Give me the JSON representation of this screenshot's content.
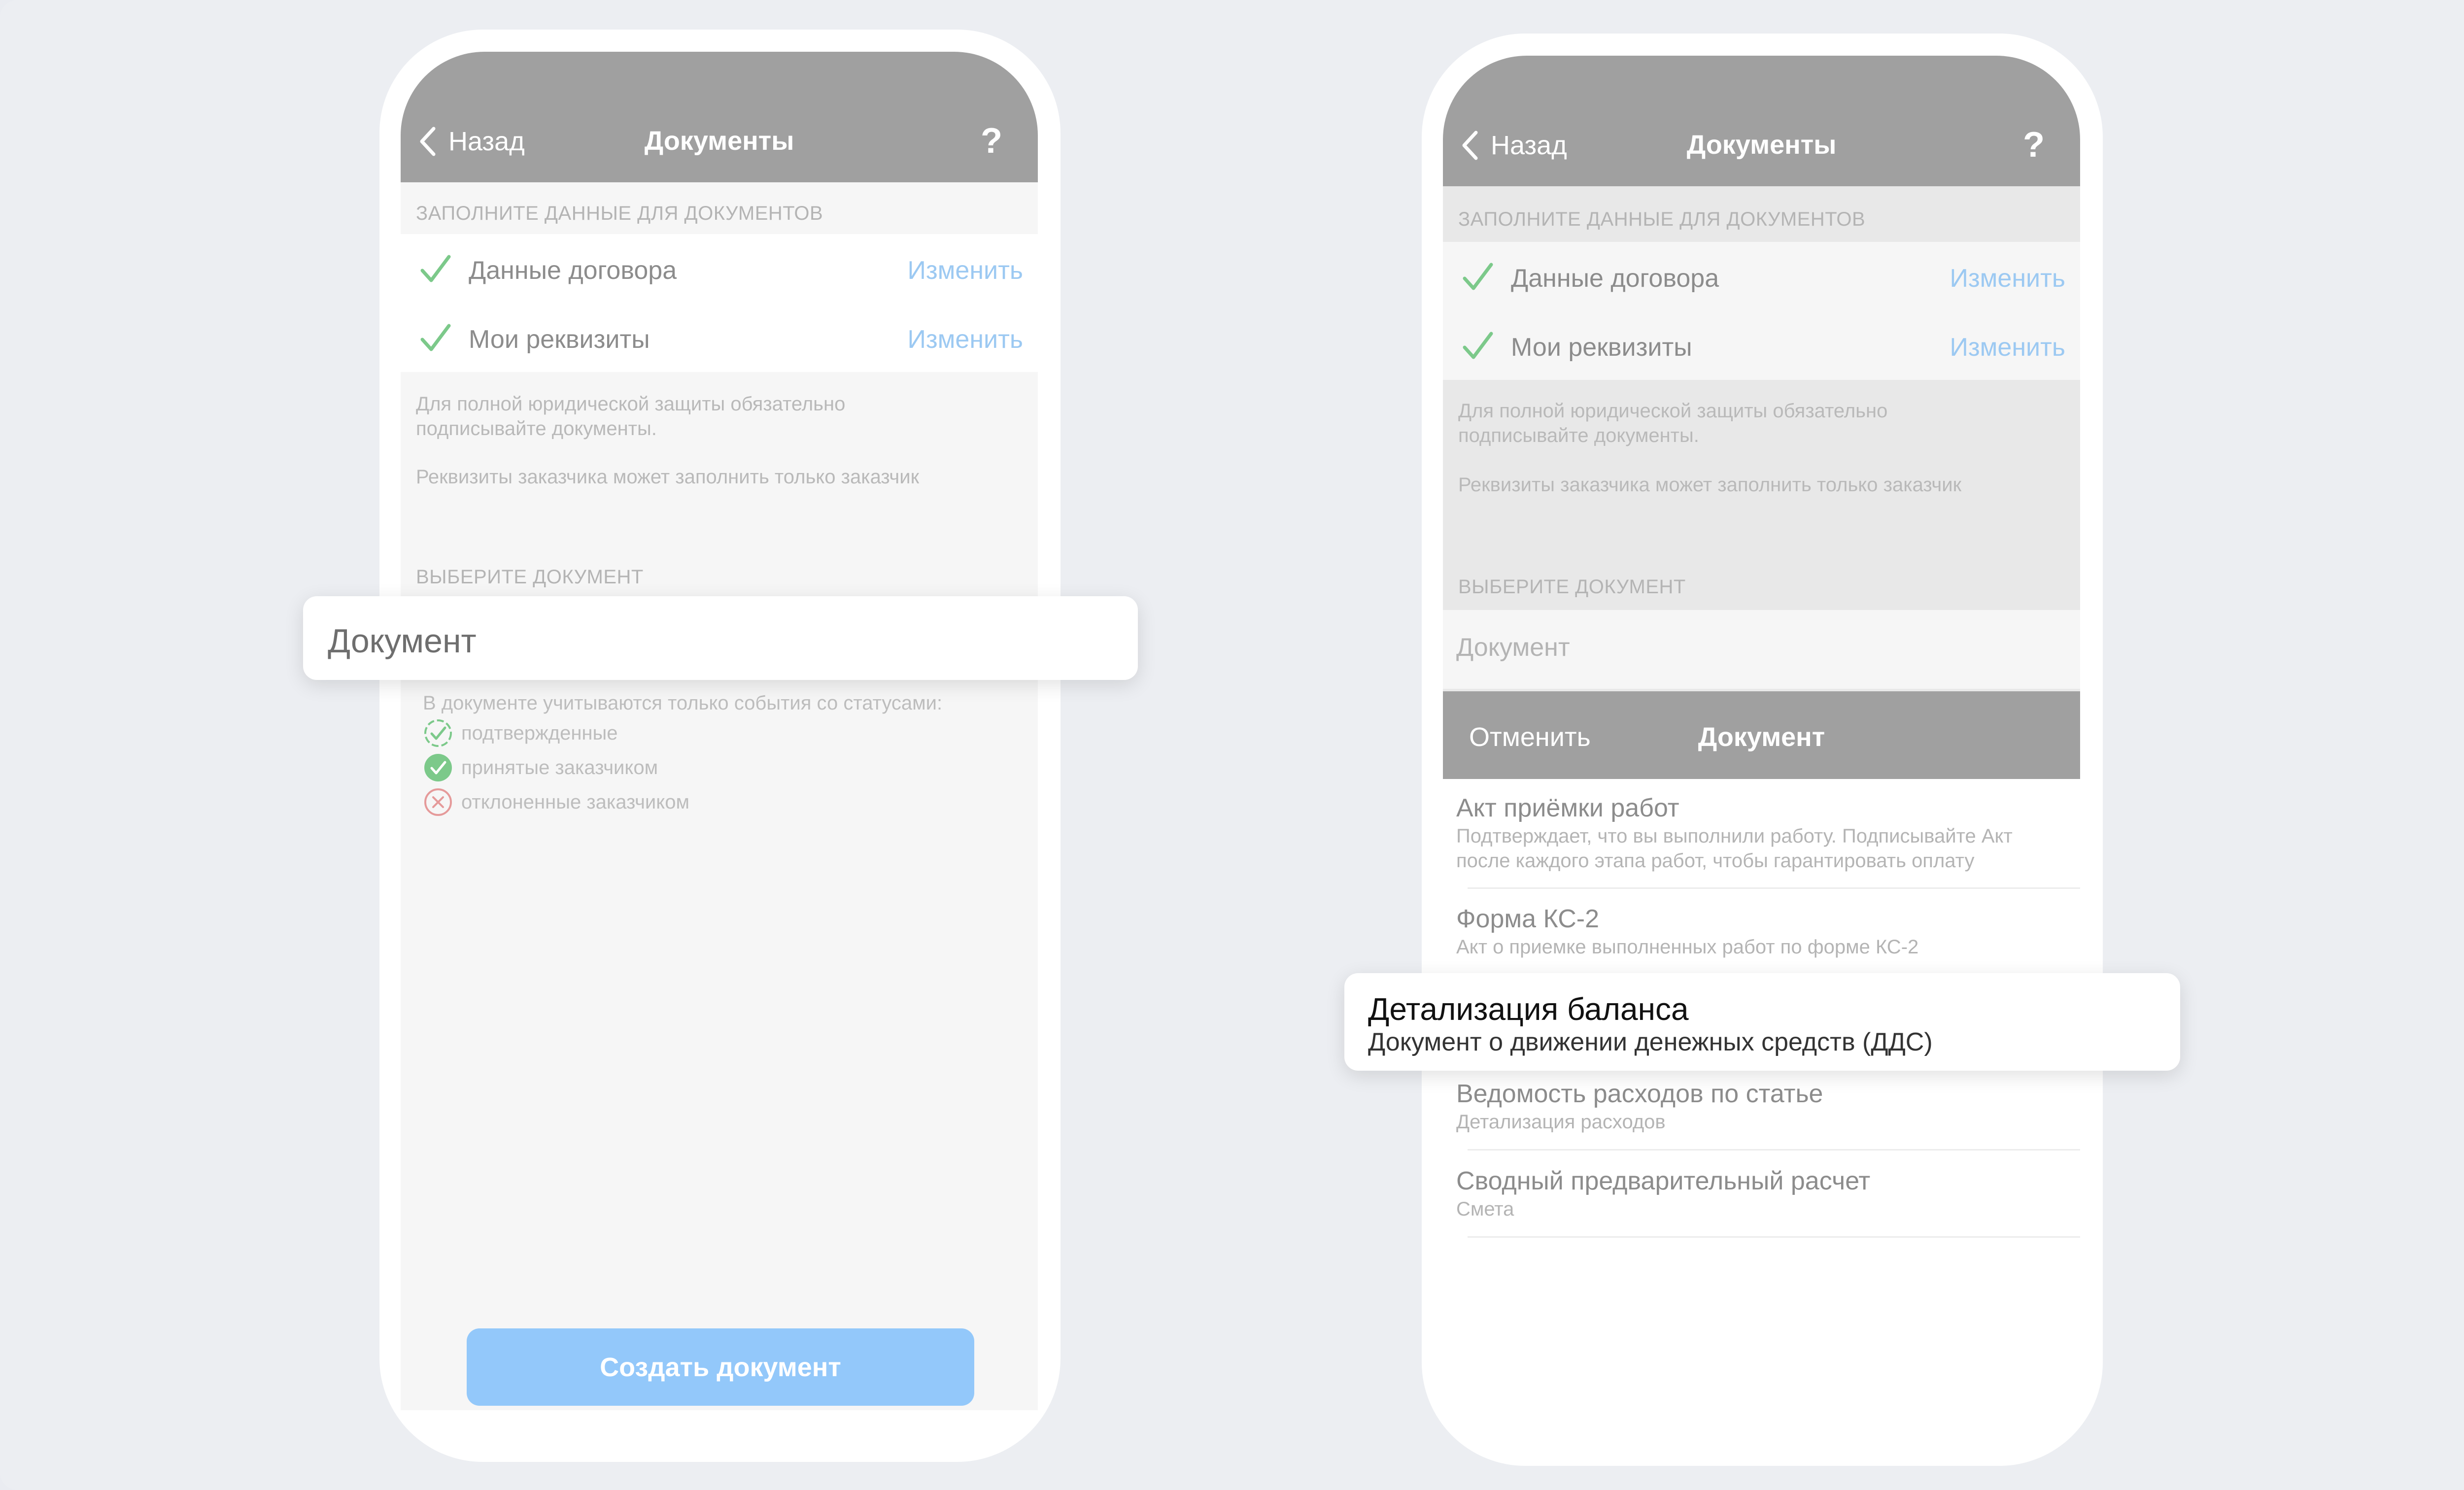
{
  "left_screen": {
    "nav": {
      "back_label": "Назад",
      "title": "Документы",
      "help": "?"
    },
    "section_fill": "ЗАПОЛНИТЕ ДАННЫЕ ДЛЯ ДОКУМЕНТОВ",
    "rows": [
      {
        "label": "Данные договора",
        "action": "Изменить"
      },
      {
        "label": "Мои реквизиты",
        "action": "Изменить"
      }
    ],
    "note_line1": "Для полной юридической защиты обязательно",
    "note_line2": "подписывайте документы.",
    "note_line3": "Реквизиты заказчика может заполнить только заказчик",
    "section_choose": "ВЫБЕРИТЕ ДОКУМЕНТ",
    "document_field": "Документ",
    "legend_title": "В документе учитываются только события со статусами:",
    "legend_items": [
      {
        "label": "подтвержденные",
        "icon": "dashed-check-icon"
      },
      {
        "label": "принятые заказчиком",
        "icon": "filled-check-icon"
      },
      {
        "label": "отклоненные заказчиком",
        "icon": "cross-circle-icon"
      }
    ],
    "create_button": "Создать документ"
  },
  "right_screen": {
    "nav": {
      "back_label": "Назад",
      "title": "Документы",
      "help": "?"
    },
    "section_fill": "ЗАПОЛНИТЕ ДАННЫЕ ДЛЯ ДОКУМЕНТОВ",
    "rows": [
      {
        "label": "Данные договора",
        "action": "Изменить"
      },
      {
        "label": "Мои реквизиты",
        "action": "Изменить"
      }
    ],
    "note_line1": "Для полной юридической защиты обязательно",
    "note_line2": "подписывайте документы.",
    "note_line3": "Реквизиты заказчика может заполнить только заказчик",
    "section_choose": "ВЫБЕРИТЕ ДОКУМЕНТ",
    "document_placeholder": "Документ",
    "sheet": {
      "cancel": "Отменить",
      "title": "Документ",
      "options": [
        {
          "title": "Акт приёмки работ",
          "sub1": "Подтверждает, что вы выполнили работу. Подписывайте Акт",
          "sub2": "после каждого этапа работ, чтобы гарантировать оплату"
        },
        {
          "title": "Форма КС-2",
          "sub1": "Акт о приемке выполненных работ по форме КС-2"
        },
        {
          "title": "Детализация баланса",
          "sub1": "Документ о движении денежных средств (ДДС)"
        },
        {
          "title": "Ведомость расходов по статье",
          "sub1": "Детализация расходов"
        },
        {
          "title": "Сводный предварительный расчет",
          "sub1": "Смета"
        }
      ]
    }
  },
  "colors": {
    "nav_bar": "#a0a0a0",
    "link": "#9cc9f2",
    "check": "#7cc98a",
    "button": "#93c8fa",
    "error": "#e59a9a",
    "background": "#eceef2"
  }
}
